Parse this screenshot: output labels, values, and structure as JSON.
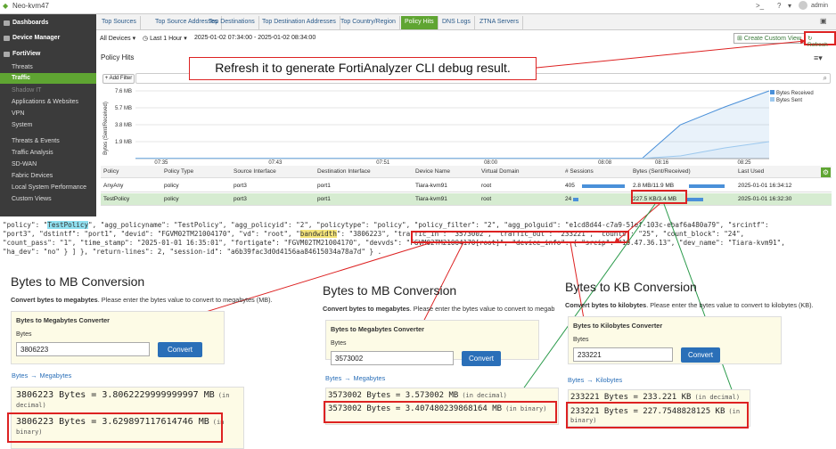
{
  "app": {
    "host": "Neo-kvm47",
    "user": "admin"
  },
  "sidebar": {
    "items": [
      {
        "label": "Dashboards",
        "type": "head"
      },
      {
        "label": "Device Manager",
        "type": "head"
      },
      {
        "label": "FortiView",
        "type": "head"
      },
      {
        "label": "Threats",
        "type": "sub"
      },
      {
        "label": "Traffic",
        "type": "active"
      },
      {
        "label": "Shadow IT",
        "type": "dim"
      },
      {
        "label": "Applications & Websites",
        "type": "sub"
      },
      {
        "label": "VPN",
        "type": "sub"
      },
      {
        "label": "System",
        "type": "sub"
      },
      {
        "label": "Threats & Events",
        "type": "sub"
      },
      {
        "label": "Traffic Analysis",
        "type": "sub"
      },
      {
        "label": "SD-WAN",
        "type": "sub"
      },
      {
        "label": "Fabric Devices",
        "type": "sub"
      },
      {
        "label": "Local System Performance",
        "type": "sub"
      },
      {
        "label": "Custom Views",
        "type": "sub"
      }
    ]
  },
  "tabs": [
    "Top Sources",
    "Top Source Addresses",
    "Top Destinations",
    "Top Destination Addresses",
    "Top Country/Region",
    "Policy Hits",
    "DNS Logs",
    "ZTNA Servers"
  ],
  "filter": {
    "devices": "All Devices",
    "period": "Last 1 Hour",
    "range": "2025-01-02 07:34:00 - 2025-01-02 08:34:00",
    "custom_view": "Create Custom View",
    "refresh": "Refresh"
  },
  "panel": {
    "title": "Policy Hits",
    "add_filter": "+ Add Filter"
  },
  "callout": "Refresh it to generate FortiAnalyzer CLI debug result.",
  "chart_data": {
    "type": "area",
    "ylabel": "Bytes (Sent/Received)",
    "yticks": [
      "7.6 MB",
      "5.7 MB",
      "3.8 MB",
      "1.9 MB"
    ],
    "xticks": [
      "07:35",
      "07:43",
      "07:51",
      "08:00",
      "08:08",
      "08:16",
      "08:25"
    ],
    "legend": [
      "Bytes Received",
      "Bytes Sent"
    ],
    "series": [
      {
        "name": "Bytes Received",
        "color": "#4a90d9",
        "x": [
          0,
          0.8,
          0.86,
          0.93,
          1.0
        ],
        "y": [
          0.05,
          0.05,
          3.8,
          5.8,
          7.6
        ]
      },
      {
        "name": "Bytes Sent",
        "color": "#9cc8ee",
        "x": [
          0,
          0.8,
          0.86,
          0.93,
          1.0
        ],
        "y": [
          0.02,
          0.02,
          0.3,
          1.2,
          1.9
        ]
      }
    ]
  },
  "table": {
    "headers": [
      "Policy",
      "Policy Type",
      "Source Interface",
      "Destination Interface",
      "Device Name",
      "Virtual Domain",
      "# Sessions",
      "Bytes (Sent/Received)",
      "Last Used"
    ],
    "rows": [
      [
        "AnyAny",
        "policy",
        "port3",
        "port1",
        "Tiara-kvm91",
        "root",
        "405",
        "2.8 MB/11.9 MB",
        "2025-01-01 16:34:12"
      ],
      [
        "TestPolicy",
        "policy",
        "port3",
        "port1",
        "Tiara-kvm91",
        "root",
        "24",
        "227.5 KB/3.4 MB",
        "2025-01-01 16:32:30"
      ]
    ]
  },
  "json_lines": [
    [
      "\"policy\": \"",
      "TestPolicy",
      "\", \"agg_policyname\": \"TestPolicy\", \"agg_policyid\": \"2\", \"policytype\": \"policy\", \"policy_filter\": \"2\", \"agg_polguid\": \"e1cd8d44-c7a9-51ef-103c-ebaf6a480a79\", \"srcintf\":"
    ],
    [
      "\"port3\", \"dstintf\": \"port1\", \"devid\": \"FGVM02TM21004170\", \"vd\": \"root\", \"",
      "bandwidth",
      "\": \"3806223\", \"traffic_in\": \"3573002\", \"traffic_out\": \"233221\", \"counts\": \"25\", \"count_block\": \"24\","
    ],
    [
      "\"count_pass\": \"1\", \"time_stamp\": \"2025-01-01 16:35:01\", \"fortigate\": \"FGVM02TM21004170\", \"devvds\": \"FGVM02TM21004170[root]\", \"device_info\": { \"srcip\": \"10.47.36.13\", \"dev_name\": \"Tiara-kvm91\","
    ],
    [
      "\"ha_dev\": \"no\" } ] }, \"return-lines\": 2, \"session-id\": \"a6b39fac3d0d4156aa84615034a78a7d\" } ."
    ]
  ],
  "converters": [
    {
      "title": "Bytes to MB Conversion",
      "sub_bold": "Convert bytes to megabytes",
      "sub_rest": ". Please enter the bytes value to convert to megabytes (MB).",
      "panel_title": "Bytes to Megabytes Converter",
      "label": "Bytes",
      "value": "3806223",
      "button": "Convert",
      "link1": "Bytes",
      "link2": "Megabytes",
      "res1": "3806223 Bytes = 3.8062229999999997 MB",
      "res1_note": "(in decimal)",
      "res2": "3806223 Bytes = 3.629897117614746 MB",
      "res2_note": "(in binary)"
    },
    {
      "title": "Bytes to MB Conversion",
      "sub_bold": "Convert bytes to megabytes",
      "sub_rest": ". Please enter the bytes value to convert to megab",
      "panel_title": "Bytes to Megabytes Converter",
      "label": "Bytes",
      "value": "3573002",
      "button": "Convert",
      "link1": "Bytes",
      "link2": "Megabytes",
      "res1": "3573002 Bytes = 3.573002 MB",
      "res1_note": "(in decimal)",
      "res2": "3573002 Bytes = 3.407480239868164 MB",
      "res2_note": "(in binary)"
    },
    {
      "title": "Bytes to KB Conversion",
      "sub_bold": "Convert bytes to kilobytes",
      "sub_rest": ". Please enter the bytes value to convert to kilobytes (KB).",
      "panel_title": "Bytes to Kilobytes Converter",
      "label": "Bytes",
      "value": "233221",
      "button": "Convert",
      "link1": "Bytes",
      "link2": "Kilobytes",
      "res1": "233221 Bytes = 233.221 KB",
      "res1_note": "(in decimal)",
      "res2": "233221 Bytes = 227.7548828125 KB",
      "res2_note": "(in binary)"
    }
  ],
  "arrow": "→"
}
